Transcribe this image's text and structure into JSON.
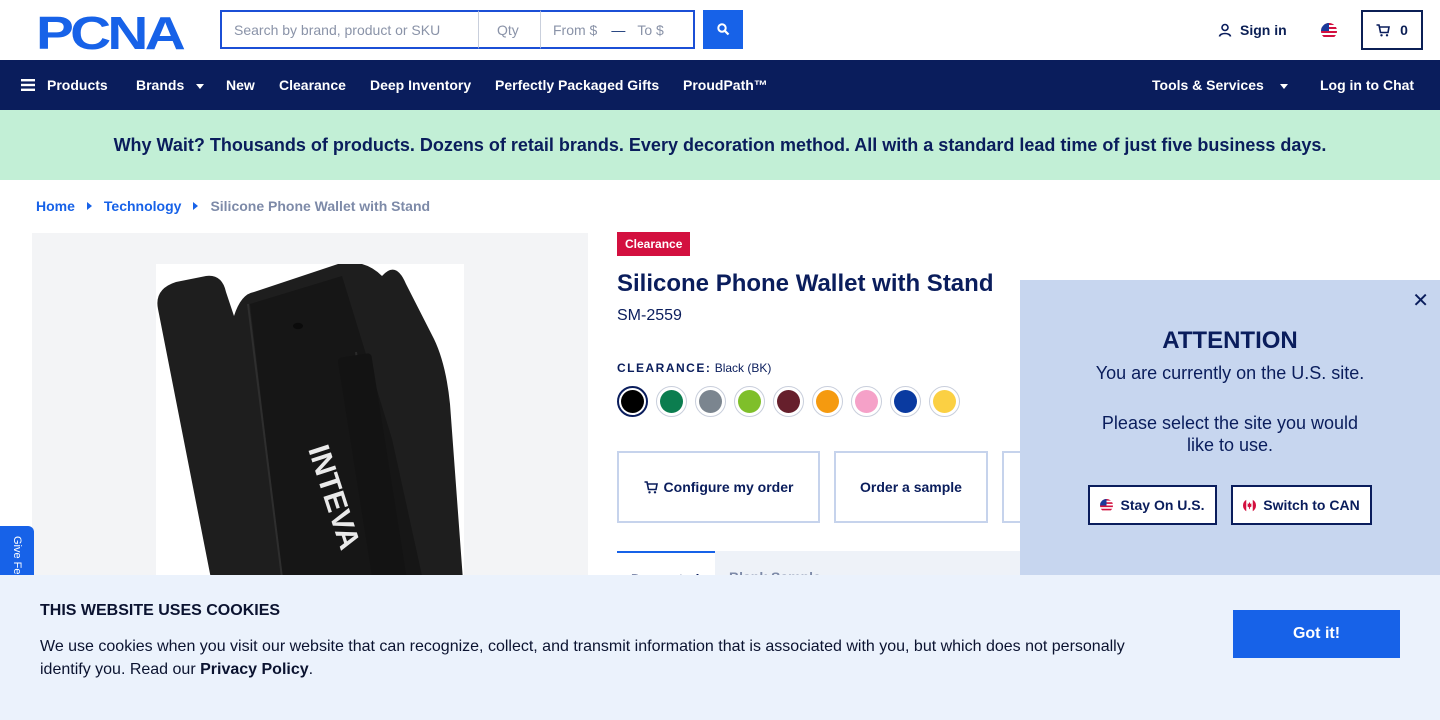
{
  "header": {
    "logo_text": "PCNA",
    "search_placeholder": "Search by brand, product or SKU",
    "qty_placeholder": "Qty",
    "from_placeholder": "From $",
    "to_placeholder": "To $",
    "sign_in": "Sign in",
    "cart_count": "0"
  },
  "nav": {
    "products": "Products",
    "brands": "Brands",
    "new": "New",
    "clearance": "Clearance",
    "deep_inventory": "Deep Inventory",
    "gifts": "Perfectly Packaged Gifts",
    "proudpath": "ProudPath™",
    "tools": "Tools & Services",
    "chat": "Log in to Chat"
  },
  "promo": "Why Wait? Thousands of products. Dozens of retail brands. Every decoration method. All with a standard lead time of just five business days.",
  "breadcrumb": {
    "home": "Home",
    "category": "Technology",
    "current": "Silicone Phone Wallet with Stand"
  },
  "feedback_tab": "Give Feedback",
  "product": {
    "badge": "Clearance",
    "title": "Silicone Phone Wallet with Stand",
    "sku": "SM-2559",
    "color_label": "CLEARANCE:",
    "color_value": "Black (BK)",
    "image_imprint": "INTEVA",
    "swatches": [
      "#000000",
      "#0b7d4f",
      "#7b858f",
      "#7fbf2a",
      "#661f2c",
      "#f59a0f",
      "#f5a1c8",
      "#0a3aa0",
      "#fbd043"
    ],
    "configure_button": "Configure my order",
    "sample_button": "Order a sample",
    "tab_active": "Decorated",
    "tab_inactive": "Blank Sample"
  },
  "country_modal": {
    "heading": "ATTENTION",
    "line1": "You are currently on the U.S. site.",
    "line2": "Please select the site you would like to use.",
    "stay_button": "Stay On U.S.",
    "switch_button": "Switch to CAN"
  },
  "cookie": {
    "title": "THIS WEBSITE USES COOKIES",
    "text": "We use cookies when you visit our website that can recognize, collect, and transmit information that is associated with you, but which does not personally identify you. Read our",
    "link": "Privacy Policy",
    "end": ".",
    "button": "Got it!"
  },
  "colors": {
    "navy": "#0a1d5c",
    "accent_blue": "#1762e8",
    "promo_green": "#c2efd6",
    "clearance_red": "#d3103f"
  }
}
